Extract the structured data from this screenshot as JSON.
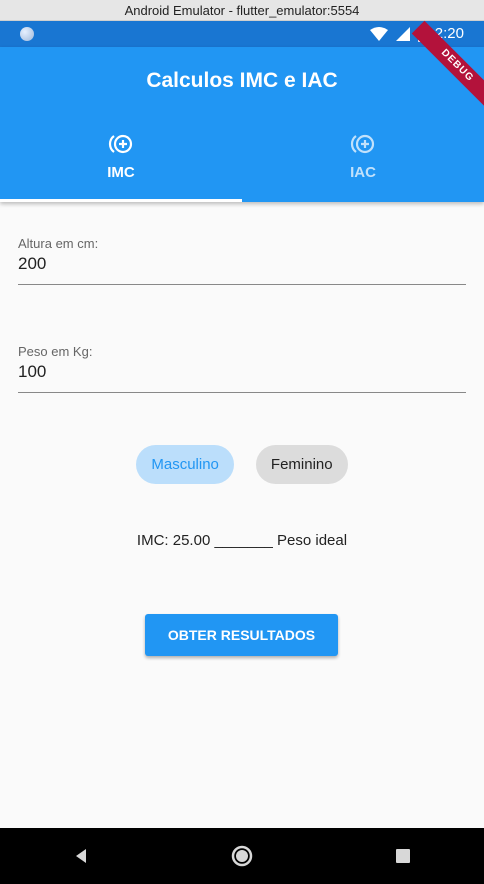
{
  "window": {
    "title": "Android Emulator - flutter_emulator:5554"
  },
  "status_bar": {
    "time": "2:20"
  },
  "app": {
    "title": "Calculos IMC e IAC",
    "debug_banner": "DEBUG"
  },
  "tabs": [
    {
      "label": "IMC",
      "icon": "add-circle-outline-icon",
      "selected": true
    },
    {
      "label": "IAC",
      "icon": "add-circle-outline-icon",
      "selected": false
    }
  ],
  "form": {
    "height": {
      "label": "Altura em cm:",
      "value": "200"
    },
    "weight": {
      "label": "Peso em Kg:",
      "value": "100"
    }
  },
  "gender": {
    "options": [
      "Masculino",
      "Feminino"
    ],
    "selected": "Masculino"
  },
  "result": {
    "text": "IMC: 25.00 _______ Peso ideal"
  },
  "action": {
    "label": "OBTER RESULTADOS"
  },
  "colors": {
    "primary": "#2196f3",
    "status_bar": "#1976d2",
    "chip_selected_bg": "#bbdefb",
    "chip_unselected_bg": "#dcdcdc",
    "debug": "#b3123b"
  },
  "system_nav": {
    "back": "back-icon",
    "home": "home-icon",
    "recents": "recents-icon"
  }
}
